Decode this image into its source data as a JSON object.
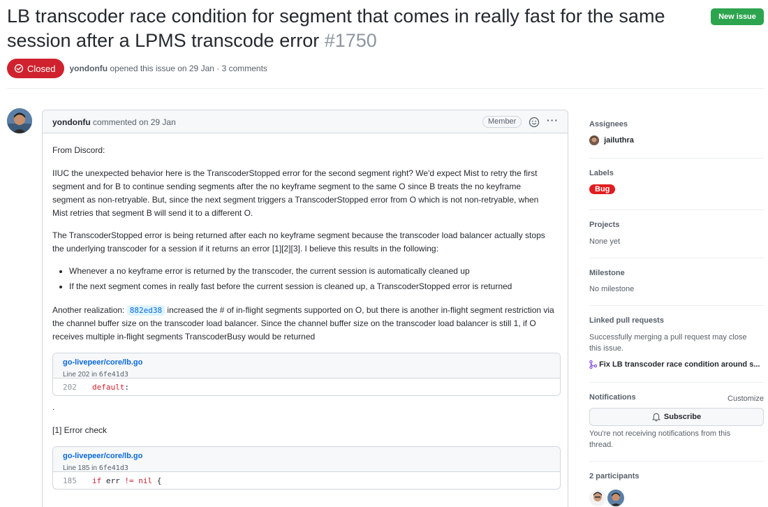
{
  "issue": {
    "title": "LB transcoder race condition for segment that comes in really fast for the same session after a LPMS transcode error",
    "number": "#1750",
    "state": "Closed",
    "author": "yondonfu",
    "opened_text": "opened this issue on 29 Jan · 3 comments",
    "new_issue_label": "New issue"
  },
  "comment": {
    "author": "yondonfu",
    "action": "commented on 29 Jan",
    "badge": "Member",
    "p1": "From Discord:",
    "p2": "IIUC the unexpected behavior here is the TranscoderStopped error for the second segment right? We'd expect Mist to retry the first segment and for B to continue sending segments after the no keyframe segment to the same O since B treats the no keyframe segment as non-retryable. But, since the next segment triggers a TranscoderStopped error from O which is not non-retryable, when Mist retries that segment B will send it to a different O.",
    "p3": "The TranscoderStopped error is being returned after each no keyframe segment because the transcoder load balancer actually stops the underlying transcoder for a session if it returns an error [1][2][3]. I believe this results in the following:",
    "bullets": [
      "Whenever a no keyframe error is returned by the transcoder, the current session is automatically cleaned up",
      "If the next segment comes in really fast before the current session is cleaned up, a TranscoderStopped error is returned"
    ],
    "p4_before": "Another realization: ",
    "p4_commit": "882ed38",
    "p4_after": " increased the # of in-flight segments supported on O, but there is another in-flight segment restriction via the channel buffer size on the transcoder load balancer. Since the channel buffer size on the transcoder load balancer is still 1, if O receives multiple in-flight segments TranscoderBusy would be returned",
    "snippet1": {
      "path": "go-livepeer/core/lb.go",
      "line_prefix": "Line 202 in ",
      "commit": "6fe41d3",
      "line_no": "202",
      "code_kw": "default",
      "code_rest": ":"
    },
    "dot": ".",
    "p5": "[1] Error check",
    "snippet2": {
      "path": "go-livepeer/core/lb.go",
      "line_prefix": "Line 185 in ",
      "commit": "6fe41d3",
      "line_no": "185",
      "code_kw1": "if",
      "code_mid": " err ",
      "code_op": "!=",
      "code_kw2": " nil",
      "code_end": " {"
    }
  },
  "sidebar": {
    "assignees_h": "Assignees",
    "assignee": "jailuthra",
    "labels_h": "Labels",
    "label": "Bug",
    "label_color": "#e11d21",
    "projects_h": "Projects",
    "projects_v": "None yet",
    "milestone_h": "Milestone",
    "milestone_v": "No milestone",
    "linked_h": "Linked pull requests",
    "linked_desc": "Successfully merging a pull request may close this issue.",
    "linked_pr": "Fix LB transcoder race condition around s...",
    "notif_h": "Notifications",
    "customize": "Customize",
    "subscribe": "Subscribe",
    "notif_desc": "You're not receiving notifications from this thread.",
    "participants_h": "2 participants"
  },
  "colors": {
    "accent_green": "#2da44e",
    "closed_red": "#cf222e",
    "link_blue": "#0969da"
  }
}
